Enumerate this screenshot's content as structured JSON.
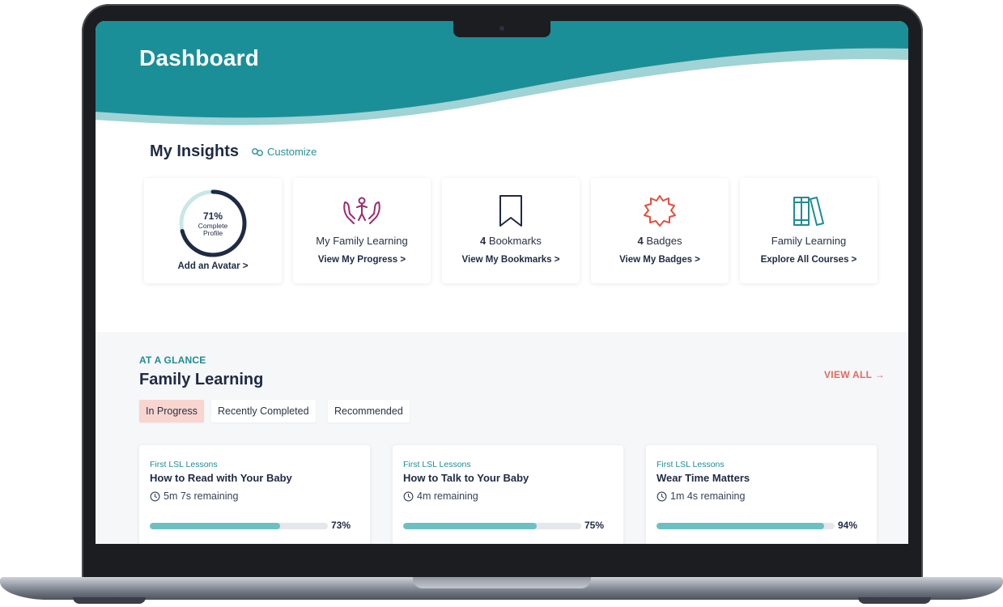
{
  "colors": {
    "header_teal": "#1b8f98",
    "wave_light": "#9fd3d6",
    "accent_coral": "#e06a5d",
    "active_tab_bg": "#f8d5cf",
    "progress_fill": "#6cc0c3"
  },
  "header": {
    "title": "Dashboard"
  },
  "insights": {
    "title": "My Insights",
    "customize_label": "Customize",
    "cards": [
      {
        "type": "profile",
        "percent_label": "71%",
        "percent_value": 71,
        "sub_label": "Complete Profile",
        "link": "Add an Avatar >"
      },
      {
        "type": "family",
        "icon": "family-hands-icon",
        "title": "My Family Learning",
        "link": "View My Progress >"
      },
      {
        "type": "bookmarks",
        "icon": "bookmark-icon",
        "count": "4",
        "title": "Bookmarks",
        "link": "View My Bookmarks >"
      },
      {
        "type": "badges",
        "icon": "badge-icon",
        "count": "4",
        "title": "Badges",
        "link": "View My Badges >"
      },
      {
        "type": "courses",
        "icon": "books-icon",
        "title": "Family Learning",
        "link": "Explore All Courses >"
      }
    ]
  },
  "glance": {
    "eyebrow": "AT A GLANCE",
    "title": "Family Learning",
    "view_all": "VIEW ALL →",
    "tabs": [
      "In Progress",
      "Recently Completed",
      "Recommended"
    ],
    "active_tab": "In Progress",
    "courses": [
      {
        "kicker": "First LSL Lessons",
        "title": "How to Read with Your Baby",
        "remaining": "5m 7s remaining",
        "progress_label": "73%",
        "progress": 0.73
      },
      {
        "kicker": "First LSL Lessons",
        "title": "How to Talk to Your Baby",
        "remaining": "4m remaining",
        "progress_label": "75%",
        "progress": 0.75
      },
      {
        "kicker": "First LSL Lessons",
        "title": "Wear Time Matters",
        "remaining": "1m 4s remaining",
        "progress_label": "94%",
        "progress": 0.94
      }
    ]
  }
}
